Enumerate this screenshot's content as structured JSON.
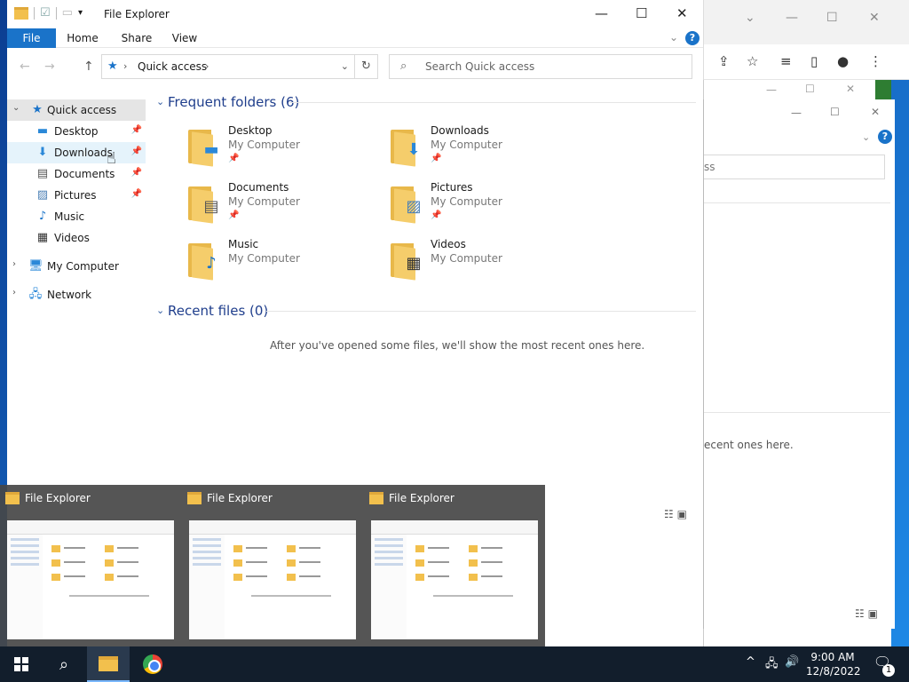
{
  "window": {
    "title": "File Explorer",
    "minimize": "—",
    "maximize": "☐",
    "close": "✕"
  },
  "ribbon": {
    "tabs": [
      "File",
      "Home",
      "Share",
      "View"
    ],
    "help": "?"
  },
  "address": {
    "location": "Quick access",
    "search_placeholder": "Search Quick access"
  },
  "sidebar": {
    "items": [
      {
        "label": "Quick access"
      },
      {
        "label": "Desktop"
      },
      {
        "label": "Downloads"
      },
      {
        "label": "Documents"
      },
      {
        "label": "Pictures"
      },
      {
        "label": "Music"
      },
      {
        "label": "Videos"
      },
      {
        "label": "My Computer"
      },
      {
        "label": "Network"
      }
    ]
  },
  "content": {
    "frequent_title": "Frequent folders (6)",
    "recent_title": "Recent files (0)",
    "recent_empty": "After you've opened some files, we'll show the most recent ones here.",
    "folders": [
      {
        "name": "Desktop",
        "location": "My Computer"
      },
      {
        "name": "Downloads",
        "location": "My Computer"
      },
      {
        "name": "Documents",
        "location": "My Computer"
      },
      {
        "name": "Pictures",
        "location": "My Computer"
      },
      {
        "name": "Music",
        "location": "My Computer"
      },
      {
        "name": "Videos",
        "location": "My Computer"
      }
    ]
  },
  "background": {
    "search_fragment": "ss",
    "recent_fragment": "ecent ones here."
  },
  "thumbnails": [
    {
      "title": "File Explorer"
    },
    {
      "title": "File Explorer"
    },
    {
      "title": "File Explorer"
    }
  ],
  "taskbar": {
    "time": "9:00 AM",
    "date": "12/8/2022",
    "notification_count": "1"
  }
}
